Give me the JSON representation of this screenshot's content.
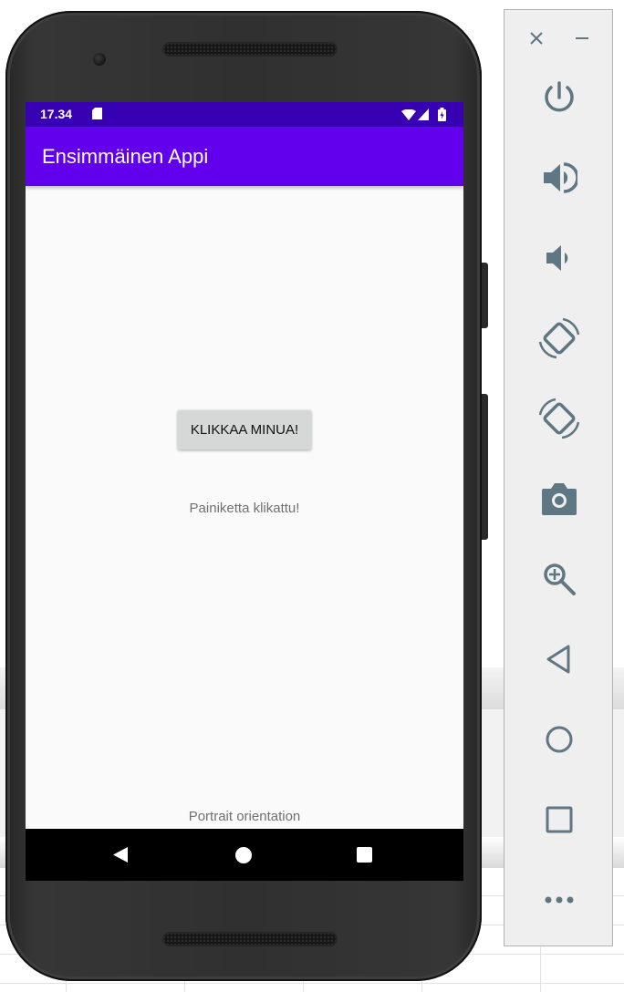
{
  "status_bar": {
    "time": "17.34",
    "icons": [
      "sd-card-icon",
      "wifi-icon",
      "signal-icon",
      "battery-charging-icon"
    ]
  },
  "app": {
    "title": "Ensimmäinen Appi",
    "button_label": "KLIKKAA MINUA!",
    "clicked_text": "Painiketta klikattu!",
    "orientation_text": "Portrait orientation"
  },
  "nav_bar": {
    "buttons": [
      "back-icon",
      "home-icon",
      "recents-icon"
    ]
  },
  "emulator_toolbar": {
    "window_controls": [
      "close-icon",
      "minimize-icon"
    ],
    "tools": [
      "power-icon",
      "volume-up-icon",
      "volume-down-icon",
      "rotate-left-icon",
      "rotate-right-icon",
      "camera-icon",
      "zoom-icon",
      "back-icon",
      "home-icon",
      "overview-icon",
      "more-icon"
    ]
  },
  "colors": {
    "status_bar": "#3700b3",
    "app_bar": "#6200ee",
    "screen_background": "#fafafa",
    "button": "#d6d7d7",
    "toolbar_icons": "#5f7783",
    "toolbar_background": "#efefef"
  }
}
